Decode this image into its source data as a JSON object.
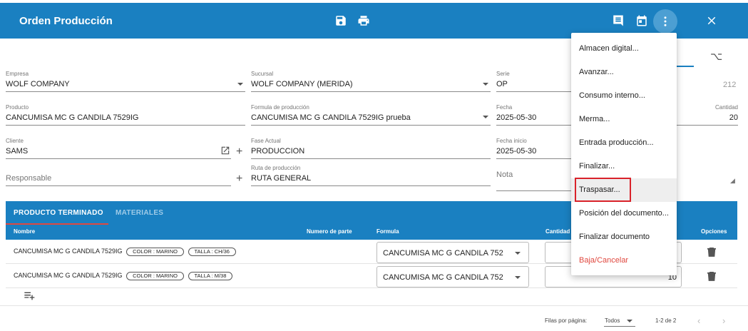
{
  "header": {
    "title": "Orden Producción",
    "bg_color": "#1a80c1"
  },
  "form": {
    "empresa": {
      "label": "Empresa",
      "value": "WOLF COMPANY"
    },
    "sucursal": {
      "label": "Sucursal",
      "value": "WOLF COMPANY (MERIDA)"
    },
    "serie": {
      "label": "Serie",
      "value": "OP",
      "number": "212"
    },
    "producto": {
      "label": "Producto",
      "value": "CANCUMISA MC G CANDILA 7529IG"
    },
    "formula": {
      "label": "Formula de producción",
      "value": "CANCUMISA MC G CANDILA 7529IG prueba"
    },
    "fecha": {
      "label": "Fecha",
      "value": "2025-05-30"
    },
    "cantidad": {
      "label": "Cantidad",
      "value": "20"
    },
    "cliente": {
      "label": "Cliente",
      "value": "SAMS"
    },
    "fase": {
      "label": "Fase Actual",
      "value": "PRODUCCION"
    },
    "fecha_inicio": {
      "label": "Fecha inicio",
      "value": "2025-05-30"
    },
    "responsable": {
      "placeholder": "Responsable"
    },
    "ruta": {
      "label": "Ruta de producción",
      "value": "RUTA GENERAL"
    },
    "nota": {
      "placeholder": "Nota"
    }
  },
  "tabs": [
    {
      "label": "PRODUCTO TERMINADO",
      "active": true
    },
    {
      "label": "MATERIALES",
      "active": false
    }
  ],
  "table": {
    "columns": [
      "Nombre",
      "Numero de parte",
      "Formula",
      "Cantidad",
      "Opciones"
    ],
    "rows": [
      {
        "name": "CANCUMISA MC G CANDILA 7529IG",
        "color_chip": "COLOR : MARINO",
        "talla_chip": "TALLA : CH/36",
        "formula": "CANCUMISA MC G CANDILA 752",
        "cantidad": ""
      },
      {
        "name": "CANCUMISA MC G CANDILA 7529IG",
        "color_chip": "COLOR : MARINO",
        "talla_chip": "TALLA : M/38",
        "formula": "CANCUMISA MC G CANDILA 752",
        "cantidad": "10"
      }
    ]
  },
  "pagination": {
    "rows_per_page_label": "Filas por página:",
    "rows_per_page_value": "Todos",
    "range": "1-2 de 2"
  },
  "menu": {
    "items": [
      "Almacen digital...",
      "Avanzar...",
      "Consumo interno...",
      "Merma...",
      "Entrada producción...",
      "Finalizar...",
      "Traspasar...",
      "Posición del documento...",
      "Finalizar documento",
      "Baja/Cancelar"
    ],
    "danger_color": "#e0483f",
    "highlight_color": "#d9222a"
  }
}
